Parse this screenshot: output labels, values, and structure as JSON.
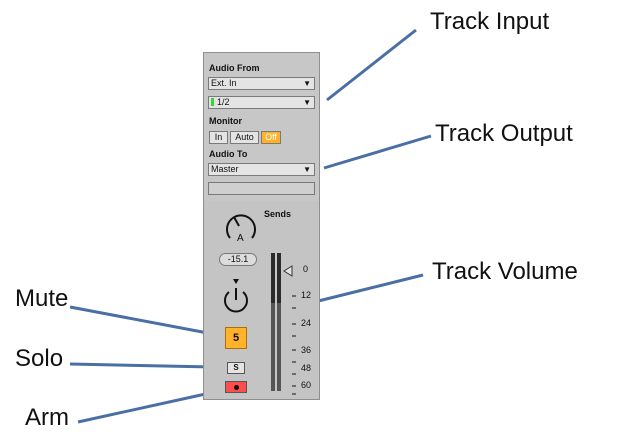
{
  "callouts": {
    "track_input": "Track Input",
    "track_output": "Track Output",
    "track_volume": "Track Volume",
    "mute": "Mute",
    "solo": "Solo",
    "arm": "Arm"
  },
  "io": {
    "audio_from_label": "Audio From",
    "input_type": "Ext. In",
    "input_channel": "1/2",
    "monitor_label": "Monitor",
    "monitor_options": [
      "In",
      "Auto",
      "Off"
    ],
    "monitor_selected": "Off",
    "audio_to_label": "Audio To",
    "output_target": "Master",
    "dropdown_arrow": "▼"
  },
  "sends": {
    "label": "Sends",
    "knob_letter": "A"
  },
  "mixer": {
    "volume_value": "-15.1",
    "mute_label": "5",
    "solo_label": "S",
    "arm_icon": "record-dot",
    "scale": [
      "0",
      "12",
      "24",
      "36",
      "48",
      "60"
    ]
  },
  "colors": {
    "active_orange": "#ffb22a",
    "arm_red": "#ff4c4c",
    "callout_line": "#4a6fa5",
    "input_chip_green": "#3bd33b"
  }
}
